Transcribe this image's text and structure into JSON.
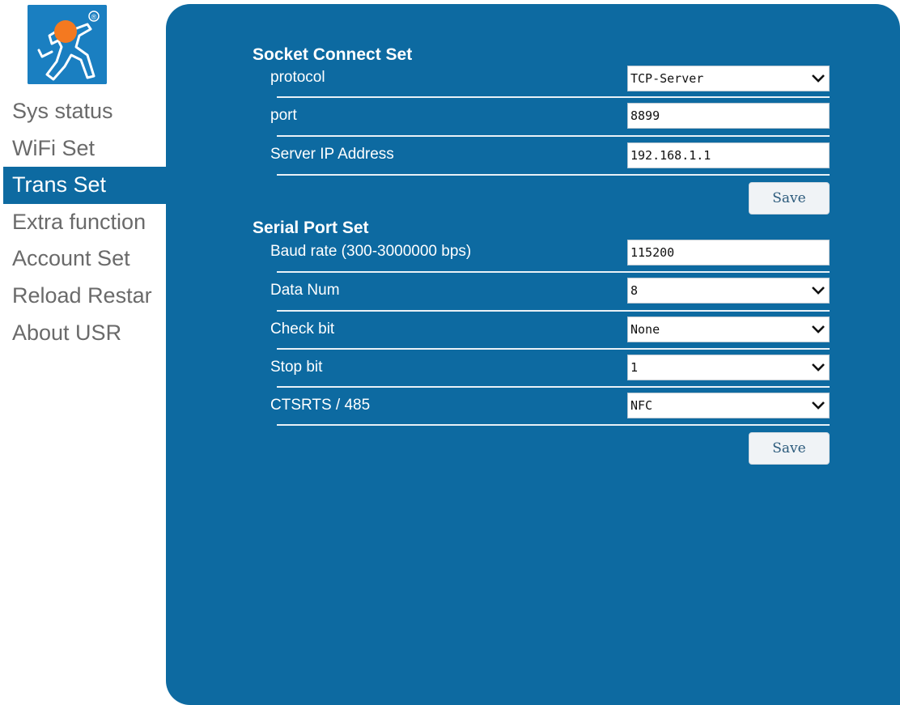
{
  "logo": {
    "name": "usr-logo",
    "registered_mark": "®"
  },
  "sidebar": {
    "items": [
      {
        "label": "Sys status"
      },
      {
        "label": "WiFi Set"
      },
      {
        "label": "Trans Set"
      },
      {
        "label": "Extra function"
      },
      {
        "label": "Account Set"
      },
      {
        "label": "Reload Restar"
      },
      {
        "label": "About USR"
      }
    ],
    "active_index": 2
  },
  "socket": {
    "title": "Socket Connect Set",
    "protocol_label": "protocol",
    "protocol_value": "TCP-Server",
    "port_label": "port",
    "port_value": "8899",
    "server_ip_label": "Server IP Address",
    "server_ip_value": "192.168.1.1",
    "save_label": "Save"
  },
  "serial": {
    "title": "Serial Port Set",
    "baud_label": "Baud rate (300-3000000 bps)",
    "baud_value": "115200",
    "data_num_label": "Data Num",
    "data_num_value": "8",
    "check_bit_label": "Check bit",
    "check_bit_value": "None",
    "stop_bit_label": "Stop bit",
    "stop_bit_value": "1",
    "flow_label": "CTSRTS / 485",
    "flow_value": "NFC",
    "save_label": "Save"
  },
  "colors": {
    "accent": "#0d6aa1",
    "logo_blue": "#1a7fc1",
    "logo_orange": "#f47920",
    "sidebar_text": "#6a6a6a"
  },
  "icons": {
    "select_arrow": "chevron-down-icon"
  }
}
